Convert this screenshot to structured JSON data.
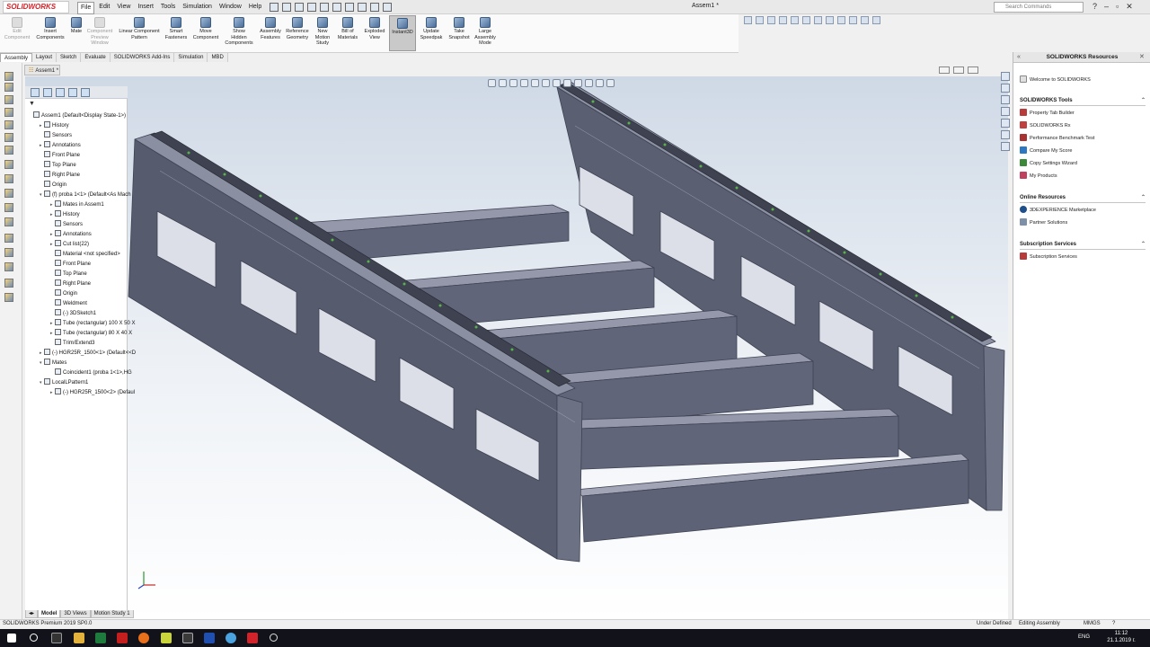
{
  "app": {
    "logo": "SOLIDWORKS",
    "doc_title": "Assem1 *"
  },
  "menu": [
    "File",
    "Edit",
    "View",
    "Insert",
    "Tools",
    "Simulation",
    "Window",
    "Help"
  ],
  "search": {
    "placeholder": "Search Commands"
  },
  "commands": [
    {
      "label": "Edit Component",
      "disabled": true
    },
    {
      "label": "Insert Components",
      "disabled": false
    },
    {
      "label": "Mate",
      "disabled": false
    },
    {
      "label": "Component Preview Window",
      "disabled": true
    },
    {
      "label": "Linear Component Pattern",
      "disabled": false
    },
    {
      "label": "Smart Fasteners",
      "disabled": false
    },
    {
      "label": "Move Component",
      "disabled": false
    },
    {
      "label": "Show Hidden Components",
      "disabled": false
    },
    {
      "label": "Assembly Features",
      "disabled": false
    },
    {
      "label": "Reference Geometry",
      "disabled": false
    },
    {
      "label": "New Motion Study",
      "disabled": false
    },
    {
      "label": "Bill of Materials",
      "disabled": false
    },
    {
      "label": "Exploded View",
      "disabled": false
    },
    {
      "label": "Instant3D",
      "disabled": false,
      "active": true
    },
    {
      "label": "Update Speedpak",
      "disabled": false
    },
    {
      "label": "Take Snapshot",
      "disabled": false
    },
    {
      "label": "Large Assembly Mode",
      "disabled": false
    }
  ],
  "ribbon_tabs": [
    "Assembly",
    "Layout",
    "Sketch",
    "Evaluate",
    "SOLIDWORKS Add-Ins",
    "Simulation",
    "MBD"
  ],
  "document_tab": "Assem1 *",
  "feature_tree": [
    {
      "label": "Assem1  (Default<Display State-1>)",
      "level": 0,
      "arrow": ""
    },
    {
      "label": "History",
      "level": 1,
      "arrow": "▸"
    },
    {
      "label": "Sensors",
      "level": 1,
      "arrow": ""
    },
    {
      "label": "Annotations",
      "level": 1,
      "arrow": "▸"
    },
    {
      "label": "Front Plane",
      "level": 1,
      "arrow": ""
    },
    {
      "label": "Top Plane",
      "level": 1,
      "arrow": ""
    },
    {
      "label": "Right Plane",
      "level": 1,
      "arrow": ""
    },
    {
      "label": "Origin",
      "level": 1,
      "arrow": ""
    },
    {
      "label": "(f) proba 1<1> (Default<As Mach",
      "level": 1,
      "arrow": "▾"
    },
    {
      "label": "Mates in Assem1",
      "level": 2,
      "arrow": "▸"
    },
    {
      "label": "History",
      "level": 2,
      "arrow": "▸"
    },
    {
      "label": "Sensors",
      "level": 2,
      "arrow": ""
    },
    {
      "label": "Annotations",
      "level": 2,
      "arrow": "▸"
    },
    {
      "label": "Cut list(22)",
      "level": 2,
      "arrow": "▸"
    },
    {
      "label": "Material <not specified>",
      "level": 2,
      "arrow": ""
    },
    {
      "label": "Front Plane",
      "level": 2,
      "arrow": ""
    },
    {
      "label": "Top Plane",
      "level": 2,
      "arrow": ""
    },
    {
      "label": "Right Plane",
      "level": 2,
      "arrow": ""
    },
    {
      "label": "Origin",
      "level": 2,
      "arrow": ""
    },
    {
      "label": "Weldment",
      "level": 2,
      "arrow": ""
    },
    {
      "label": "(-) 3DSketch1",
      "level": 2,
      "arrow": ""
    },
    {
      "label": "Tube (rectangular) 100 X 50 X",
      "level": 2,
      "arrow": "▸"
    },
    {
      "label": "Tube (rectangular) 80 X 40 X",
      "level": 2,
      "arrow": "▸"
    },
    {
      "label": "Trim/Extend3",
      "level": 2,
      "arrow": ""
    },
    {
      "label": "(-) HGR25R_1500<1> (Default<<D",
      "level": 1,
      "arrow": "▸"
    },
    {
      "label": "Mates",
      "level": 1,
      "arrow": "▾"
    },
    {
      "label": "Coincident1 (proba 1<1>,HG",
      "level": 2,
      "arrow": ""
    },
    {
      "label": "LocalLPattern1",
      "level": 1,
      "arrow": "▾"
    },
    {
      "label": "(-) HGR25R_1500<2> (Defaul",
      "level": 2,
      "arrow": "▸"
    }
  ],
  "bottom_tabs": [
    "",
    "Model",
    "3D Views",
    "Motion Study 1"
  ],
  "task_pane": {
    "title": "SOLIDWORKS Resources",
    "welcome": "Welcome to SOLIDWORKS",
    "sections": [
      {
        "title": "SOLIDWORKS Tools",
        "items": [
          "Property Tab Builder",
          "SOLIDWORKS Rx",
          "Performance Benchmark Test",
          "Compare My Score",
          "Copy Settings Wizard",
          "My Products"
        ]
      },
      {
        "title": "Online Resources",
        "items": [
          "3DEXPERIENCE Marketplace",
          "Partner Solutions"
        ]
      },
      {
        "title": "Subscription Services",
        "items": [
          "Subscription Services"
        ]
      }
    ]
  },
  "status": {
    "left": "SOLIDWORKS Premium 2019 SP0.0",
    "state": "Under Defined",
    "mode": "Editing Assembly",
    "units": "MMGS"
  },
  "taskbar": {
    "lang": "ENG",
    "time": "11:12",
    "date": "21.1.2019 г."
  }
}
